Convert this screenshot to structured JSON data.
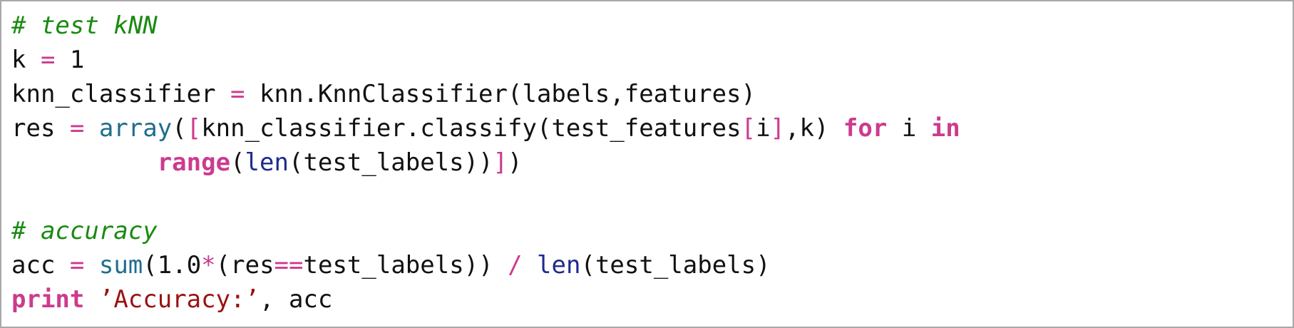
{
  "code": {
    "colors": {
      "comment": "#1a8a12",
      "operator": "#cc3b8e",
      "keyword": "#cc3b8e",
      "builtin": "#1f6d8e",
      "builtin_alt": "#1d2a8f",
      "string": "#9b1111",
      "text": "#111111",
      "border": "#a9a9a9"
    },
    "lines": [
      [
        {
          "t": "# test kNN",
          "c": "comment"
        }
      ],
      [
        {
          "t": "k ",
          "c": "plain"
        },
        {
          "t": "=",
          "c": "op"
        },
        {
          "t": " 1",
          "c": "plain"
        }
      ],
      [
        {
          "t": "knn_classifier ",
          "c": "plain"
        },
        {
          "t": "=",
          "c": "op"
        },
        {
          "t": " knn.KnnClassifier(labels,features)",
          "c": "plain"
        }
      ],
      [
        {
          "t": "res ",
          "c": "plain"
        },
        {
          "t": "=",
          "c": "op"
        },
        {
          "t": " ",
          "c": "plain"
        },
        {
          "t": "array",
          "c": "builtin"
        },
        {
          "t": "(",
          "c": "plain"
        },
        {
          "t": "[",
          "c": "op"
        },
        {
          "t": "knn_classifier.classify(test_features",
          "c": "plain"
        },
        {
          "t": "[",
          "c": "op"
        },
        {
          "t": "i",
          "c": "plain"
        },
        {
          "t": "]",
          "c": "op"
        },
        {
          "t": ",k) ",
          "c": "plain"
        },
        {
          "t": "for",
          "c": "kw"
        },
        {
          "t": " i ",
          "c": "plain"
        },
        {
          "t": "in",
          "c": "kw"
        }
      ],
      [
        {
          "t": "          ",
          "c": "plain"
        },
        {
          "t": "range",
          "c": "kw"
        },
        {
          "t": "(",
          "c": "plain"
        },
        {
          "t": "len",
          "c": "builtin2"
        },
        {
          "t": "(test_labels))",
          "c": "plain"
        },
        {
          "t": "]",
          "c": "op"
        },
        {
          "t": ")",
          "c": "plain"
        }
      ],
      [],
      [
        {
          "t": "# accuracy",
          "c": "comment"
        }
      ],
      [
        {
          "t": "acc ",
          "c": "plain"
        },
        {
          "t": "=",
          "c": "op"
        },
        {
          "t": " ",
          "c": "plain"
        },
        {
          "t": "sum",
          "c": "builtin"
        },
        {
          "t": "(1.0",
          "c": "plain"
        },
        {
          "t": "*",
          "c": "op"
        },
        {
          "t": "(res",
          "c": "plain"
        },
        {
          "t": "==",
          "c": "op"
        },
        {
          "t": "test_labels)) ",
          "c": "plain"
        },
        {
          "t": "/",
          "c": "op"
        },
        {
          "t": " ",
          "c": "plain"
        },
        {
          "t": "len",
          "c": "builtin2"
        },
        {
          "t": "(test_labels)",
          "c": "plain"
        }
      ],
      [
        {
          "t": "print",
          "c": "kw"
        },
        {
          "t": " ",
          "c": "plain"
        },
        {
          "t": "’Accuracy:’",
          "c": "str"
        },
        {
          "t": ", acc",
          "c": "plain"
        }
      ]
    ]
  }
}
